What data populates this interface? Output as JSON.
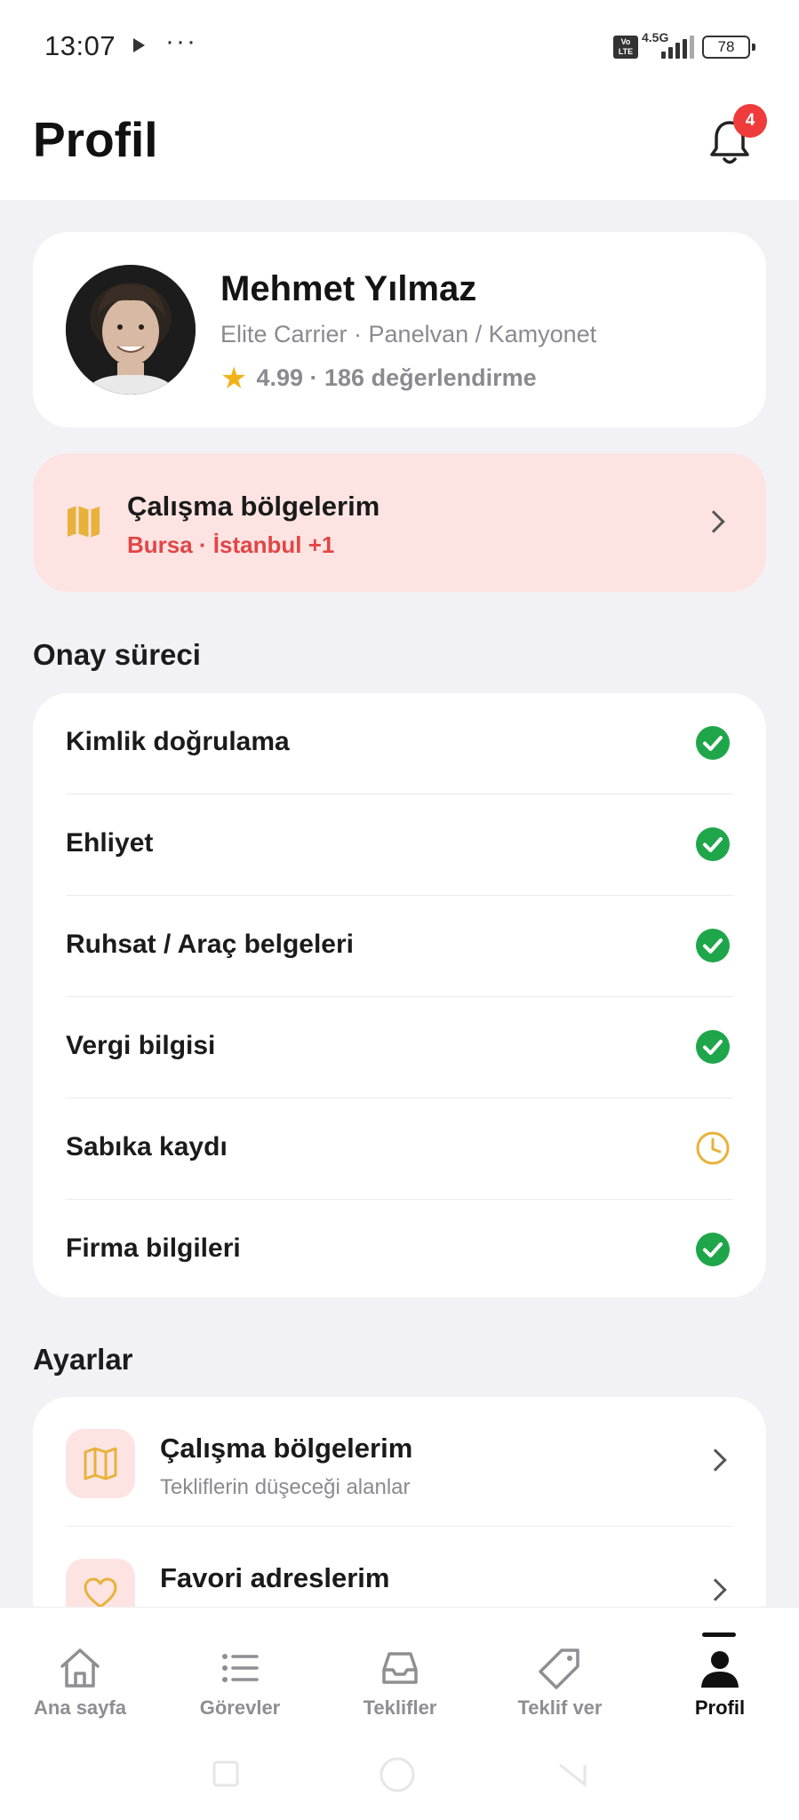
{
  "status_bar": {
    "time": "13:07",
    "dots": "···",
    "volte": "Vo LTE",
    "network": "4.5G",
    "battery": "78"
  },
  "header": {
    "title": "Profil",
    "notification_count": "4"
  },
  "profile": {
    "name": "Mehmet Yılmaz",
    "subtitle": "Elite Carrier · Panelvan / Kamyonet",
    "rating": "4.99 · 186 değerlendirme"
  },
  "region_banner": {
    "title": "Çalışma bölgelerim",
    "subtitle": "Bursa · İstanbul +1"
  },
  "approval": {
    "title": "Onay süreci",
    "items": [
      {
        "label": "Kimlik doğrulama",
        "status": "done"
      },
      {
        "label": "Ehliyet",
        "status": "done"
      },
      {
        "label": "Ruhsat / Araç belgeleri",
        "status": "done"
      },
      {
        "label": "Vergi bilgisi",
        "status": "done"
      },
      {
        "label": "Sabıka kaydı",
        "status": "pending"
      },
      {
        "label": "Firma bilgileri",
        "status": "done"
      }
    ]
  },
  "settings": {
    "title": "Ayarlar",
    "items": [
      {
        "title": "Çalışma bölgelerim",
        "subtitle": "Tekliflerin düşeceği alanlar",
        "icon": "map-icon"
      },
      {
        "title": "Favori adreslerim",
        "subtitle": "",
        "icon": "heart-icon"
      }
    ]
  },
  "tabbar": {
    "items": [
      {
        "label": "Ana sayfa",
        "icon": "home-icon"
      },
      {
        "label": "Görevler",
        "icon": "list-icon"
      },
      {
        "label": "Teklifler",
        "icon": "inbox-icon"
      },
      {
        "label": "Teklif ver",
        "icon": "tag-icon"
      },
      {
        "label": "Profil",
        "icon": "person-icon"
      }
    ],
    "active": "Profil"
  },
  "colors": {
    "accent_red": "#e24646",
    "badge_red": "#ef3b3b",
    "success_green": "#1fa64a",
    "pending_amber": "#e8b23a",
    "banner_bg": "#fde4e3"
  }
}
